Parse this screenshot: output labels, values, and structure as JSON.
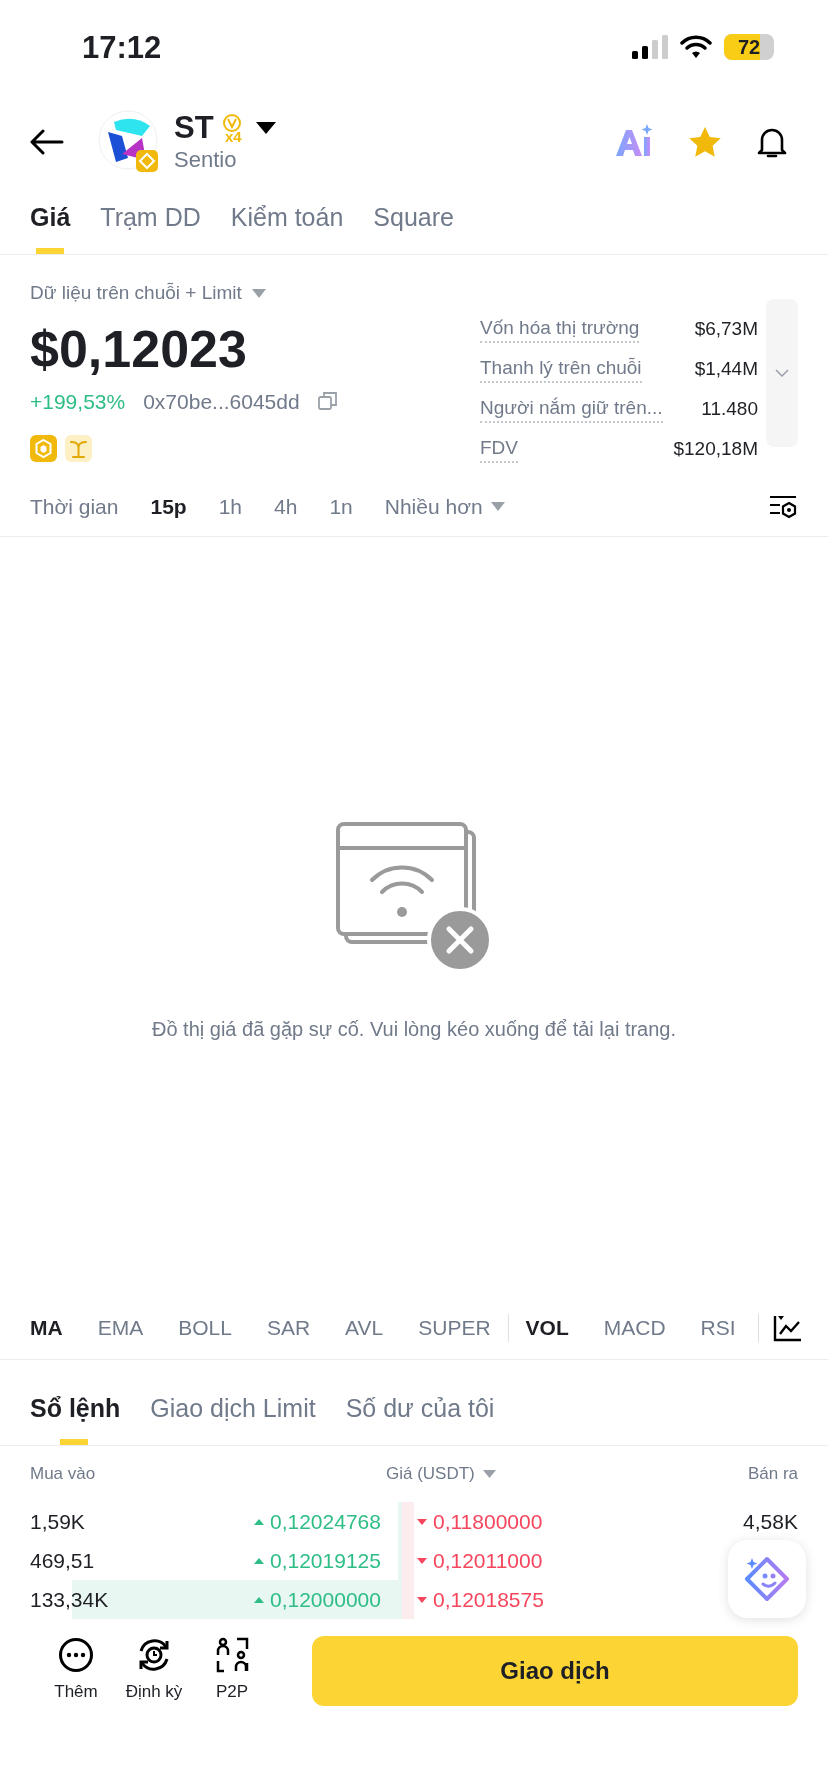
{
  "status_bar": {
    "time": "17:12",
    "battery": "72"
  },
  "header": {
    "symbol": "ST",
    "badge": "x4",
    "name": "Sentio"
  },
  "tabs": [
    {
      "label": "Giá",
      "selected": true
    },
    {
      "label": "Trạm DD",
      "selected": false
    },
    {
      "label": "Kiểm toán",
      "selected": false
    },
    {
      "label": "Square",
      "selected": false
    }
  ],
  "source": "Dữ liệu trên chuỗi + Limit",
  "price": "$0,12023",
  "change": "+199,53%",
  "address": "0x70be...6045dd",
  "stats": [
    {
      "label": "Vốn hóa thị trường",
      "value": "$6,73M"
    },
    {
      "label": "Thanh lý trên chuỗi",
      "value": "$1,44M"
    },
    {
      "label": "Người nắm giữ trên...",
      "value": "11.480"
    },
    {
      "label": "FDV",
      "value": "$120,18M"
    }
  ],
  "timeframes": [
    {
      "label": "Thời gian",
      "selected": false
    },
    {
      "label": "15p",
      "selected": true
    },
    {
      "label": "1h",
      "selected": false
    },
    {
      "label": "4h",
      "selected": false
    },
    {
      "label": "1n",
      "selected": false
    }
  ],
  "more_timeframes": "Nhiều hơn",
  "chart_error": "Đồ thị giá đã gặp sự cố. Vui lòng kéo xuống để tải lại trang.",
  "main_indicators": [
    {
      "label": "MA",
      "selected": true
    },
    {
      "label": "EMA",
      "selected": false
    },
    {
      "label": "BOLL",
      "selected": false
    },
    {
      "label": "SAR",
      "selected": false
    },
    {
      "label": "AVL",
      "selected": false
    },
    {
      "label": "SUPER",
      "selected": false
    }
  ],
  "sub_indicators": [
    {
      "label": "VOL",
      "selected": true
    },
    {
      "label": "MACD",
      "selected": false
    },
    {
      "label": "RSI",
      "selected": false
    }
  ],
  "book_tabs": [
    {
      "label": "Sổ lệnh",
      "selected": true
    },
    {
      "label": "Giao dịch Limit",
      "selected": false
    },
    {
      "label": "Số dư của tôi",
      "selected": false
    }
  ],
  "order_book": {
    "columns": [
      "Mua vào",
      "Giá (USDT)",
      "Bán ra"
    ],
    "rows": [
      {
        "bid_amount": "1,59K",
        "bid_price": "0,12024768",
        "ask_price": "0,11800000",
        "ask_amount": "4,58K"
      },
      {
        "bid_amount": "469,51",
        "bid_price": "0,12019125",
        "ask_price": "0,12011000"
      },
      {
        "bid_amount": "133,34K",
        "bid_price": "0,12000000",
        "ask_price": "0,12018575"
      }
    ]
  },
  "bottom_actions": [
    {
      "label": "Thêm",
      "kind": "more"
    },
    {
      "label": "Định kỳ",
      "kind": "recurring"
    },
    {
      "label": "P2P",
      "kind": "p2p"
    }
  ],
  "trade_button": "Giao dịch"
}
